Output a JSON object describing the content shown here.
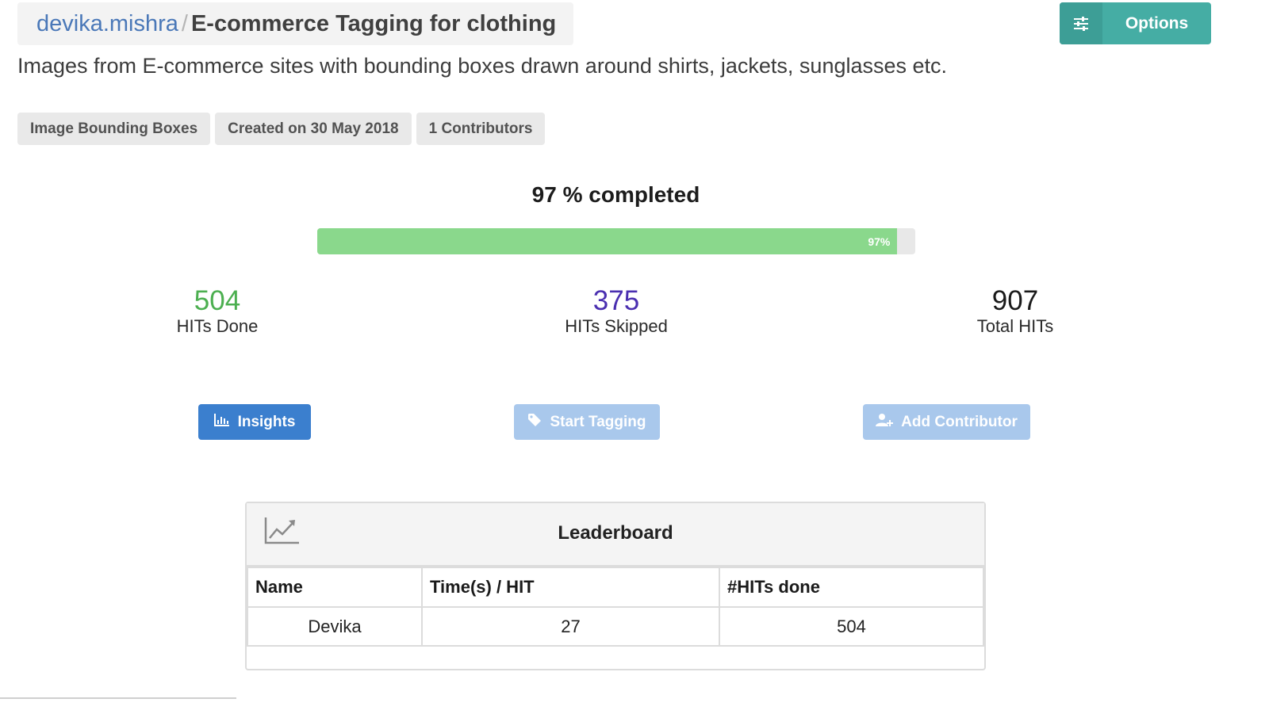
{
  "breadcrumb": {
    "user": "devika.mishra",
    "separator": "/",
    "project": "E-commerce Tagging for clothing"
  },
  "options_button": {
    "label": "Options",
    "icon": "sliders-icon"
  },
  "description": "Images from E-commerce sites with bounding boxes drawn around shirts, jackets, sunglasses etc.",
  "tags": [
    "Image Bounding Boxes",
    "Created on 30 May 2018",
    "1 Contributors"
  ],
  "progress": {
    "title": "97 % completed",
    "percent": 97,
    "bar_label": "97%"
  },
  "stats": {
    "done": {
      "value": "504",
      "label": "HITs Done",
      "color": "#4caf50"
    },
    "skipped": {
      "value": "375",
      "label": "HITs Skipped",
      "color": "#4a2fb0"
    },
    "total": {
      "value": "907",
      "label": "Total HITs",
      "color": "#1a1a1a"
    }
  },
  "actions": {
    "insights": {
      "label": "Insights",
      "icon": "bar-chart-icon"
    },
    "start_tagging": {
      "label": "Start Tagging",
      "icon": "tag-icon"
    },
    "add_contributor": {
      "label": "Add Contributor",
      "icon": "add-user-icon"
    }
  },
  "leaderboard": {
    "title": "Leaderboard",
    "icon": "line-chart-icon",
    "columns": [
      "Name",
      "Time(s) / HIT",
      "#HITs done"
    ],
    "rows": [
      [
        "Devika",
        "27",
        "504"
      ]
    ]
  },
  "colors": {
    "accent_teal": "#45ada4",
    "progress_green": "#8ad88c",
    "primary_blue": "#3b7fce",
    "disabled_blue": "#a9c8ec"
  }
}
